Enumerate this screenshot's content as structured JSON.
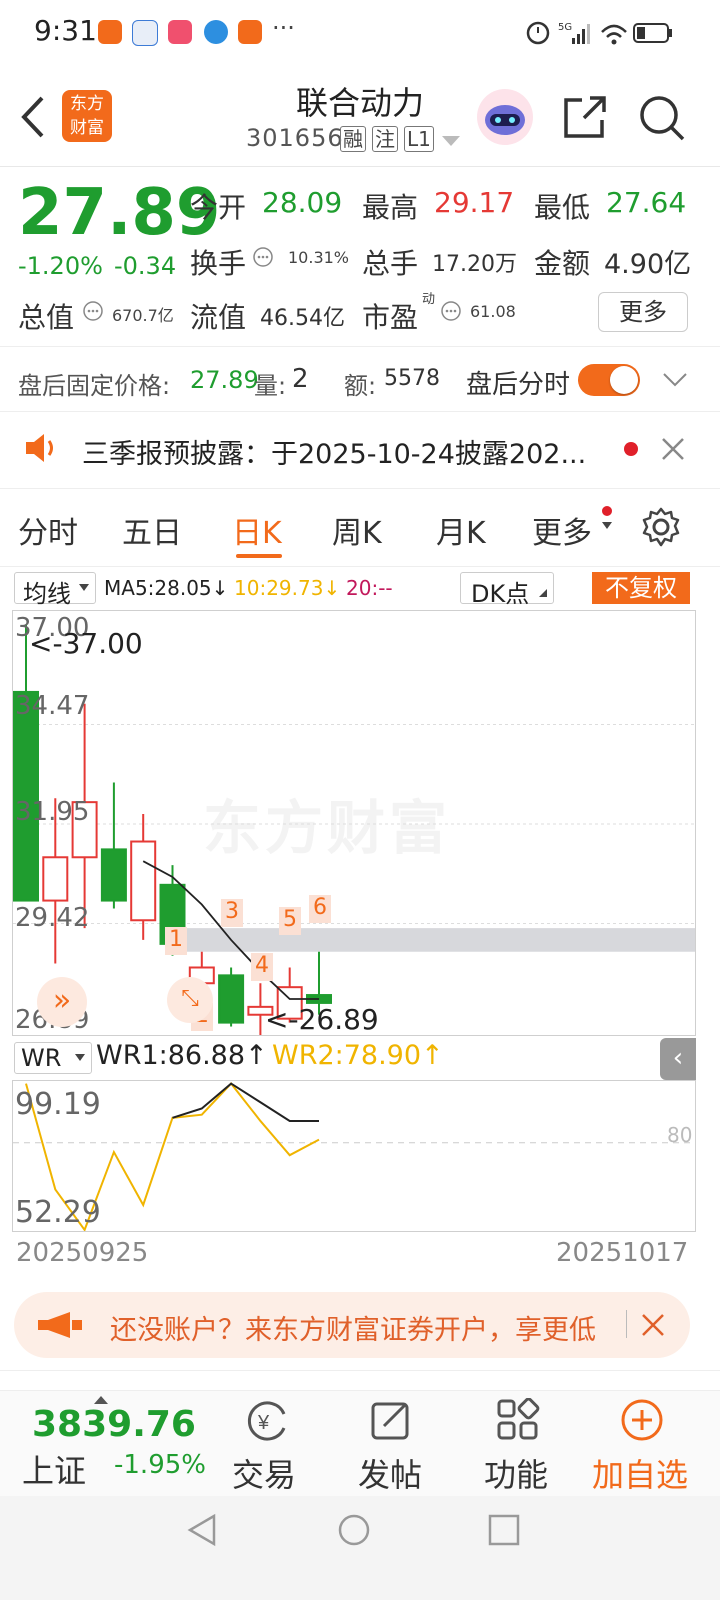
{
  "status_bar": {
    "time": "9:31",
    "more": "···",
    "signal": "5G"
  },
  "header": {
    "stock_name": "联合动力",
    "stock_code": "301656",
    "tags": [
      "融",
      "注",
      "L1"
    ],
    "logo_line1": "东方",
    "logo_line2": "财富"
  },
  "quote": {
    "price": "27.89",
    "change_pct": "-1.20%",
    "change_amt": "-0.34",
    "open_label": "今开",
    "open": "28.09",
    "high_label": "最高",
    "high": "29.17",
    "low_label": "最低",
    "low": "27.64",
    "turnover_label": "换手",
    "turnover": "10.31%",
    "volume_label": "总手",
    "volume": "17.20万",
    "amount_label": "金额",
    "amount": "4.90亿",
    "mktcap_label": "总值",
    "mktcap": "670.7亿",
    "float_label": "流值",
    "float": "46.54亿",
    "pe_label": "市盈",
    "pe_sup": "动",
    "pe": "61.08",
    "more_label": "更多"
  },
  "after_hours": {
    "price_label": "盘后固定价格:",
    "price": "27.89",
    "qty_label": "量:",
    "qty": "2",
    "amt_label": "额:",
    "amt": "5578",
    "timeshare_label": "盘后分时"
  },
  "notice": {
    "text": "三季报预披露：于2025-10-24披露202..."
  },
  "tabs": [
    "分时",
    "五日",
    "日K",
    "周K",
    "月K",
    "更多"
  ],
  "active_tab": "日K",
  "indicator": {
    "ma_select": "均线",
    "ma5": "MA5:28.05↓",
    "ma10": "10:29.73↓",
    "ma20": "20:--",
    "dk": "DK点",
    "adjust": "不复权"
  },
  "kline_axis": [
    "37.00",
    "34.47",
    "31.95",
    "29.42",
    "26.89"
  ],
  "kline_annotations": {
    "max": "<-37.00",
    "min": "<-26.89",
    "watermark": "东方财富"
  },
  "dk_marks": [
    "1",
    "2",
    "3",
    "4",
    "5",
    "6"
  ],
  "wr": {
    "select": "WR",
    "wr1": "WR1:86.88↑",
    "wr2": "WR2:78.90↑",
    "axis_top": "99.19",
    "axis_bottom": "52.29",
    "level": "80"
  },
  "dates": {
    "start": "20250925",
    "end": "20251017"
  },
  "banner": {
    "text": "还没账户？来东方财富证券开户，享更低"
  },
  "bottom": {
    "index_value": "3839.76",
    "index_name": "上证",
    "index_change": "-1.95%",
    "nav": [
      "交易",
      "发帖",
      "功能",
      "加自选"
    ]
  },
  "colors": {
    "up": "#e53935",
    "down": "#1f9d2f",
    "accent": "#f26a1b",
    "ma10": "#f0b400",
    "ma20": "#c2185b"
  },
  "chart_data": {
    "type": "candlestick",
    "y_range": [
      26.89,
      37.0
    ],
    "candles": [
      {
        "open": 35.3,
        "close": 30.0,
        "high": 37.0,
        "low": 30.0
      },
      {
        "open": 30.0,
        "close": 31.1,
        "high": 32.6,
        "low": 28.4
      },
      {
        "open": 31.1,
        "close": 32.5,
        "high": 35.0,
        "low": 29.3
      },
      {
        "open": 31.3,
        "close": 30.0,
        "high": 33.0,
        "low": 29.8
      },
      {
        "open": 29.5,
        "close": 31.5,
        "high": 32.2,
        "low": 29.0
      },
      {
        "open": 30.4,
        "close": 28.9,
        "high": 30.9,
        "low": 28.6
      },
      {
        "open": 27.9,
        "close": 28.3,
        "high": 28.7,
        "low": 27.4
      },
      {
        "open": 28.1,
        "close": 26.9,
        "high": 28.3,
        "low": 26.8
      },
      {
        "open": 27.1,
        "close": 27.3,
        "high": 27.9,
        "low": 26.4
      },
      {
        "open": 27.0,
        "close": 27.8,
        "high": 28.3,
        "low": 26.9
      },
      {
        "open": 27.6,
        "close": 27.4,
        "high": 28.7,
        "low": 27.1
      }
    ],
    "ma5": [
      null,
      null,
      null,
      null,
      31.0,
      30.6,
      29.9,
      29.0,
      28.2,
      27.5,
      27.5
    ],
    "band": [
      28.7,
      29.3
    ],
    "wr_range": [
      52.29,
      99.19
    ],
    "wr1": [
      null,
      null,
      null,
      null,
      null,
      88,
      91,
      99,
      93,
      87,
      87
    ],
    "wr2": [
      99,
      65,
      52,
      77,
      60,
      88,
      89,
      99,
      87,
      76,
      81
    ]
  }
}
